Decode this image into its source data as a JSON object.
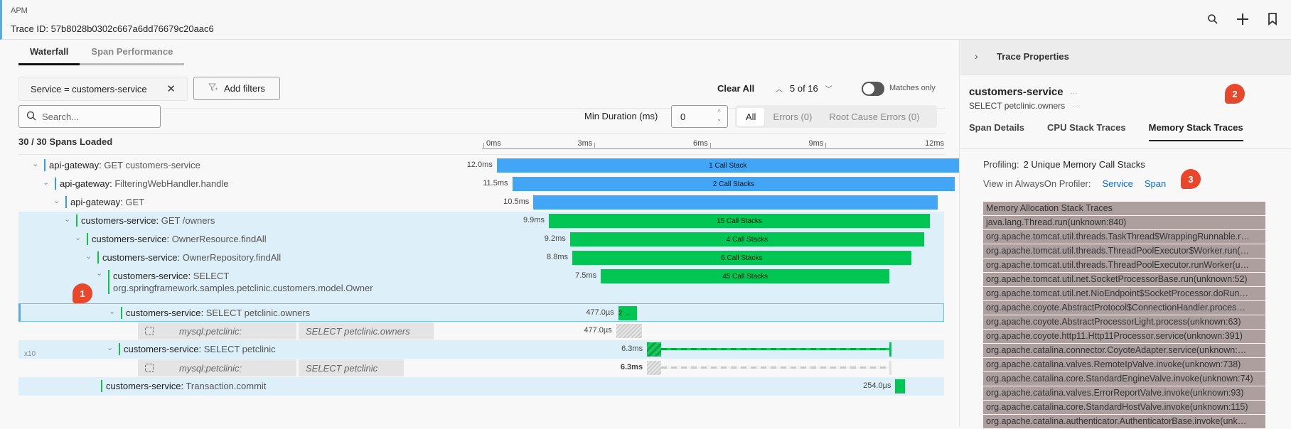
{
  "header": {
    "app_label": "APM",
    "trace_id": "Trace ID: 57b8028b0302c667a6dd76679c20aac6",
    "icons": [
      "search-icon",
      "plus-icon",
      "bookmark-icon"
    ]
  },
  "tabs": [
    {
      "label": "Waterfall",
      "active": true
    },
    {
      "label": "Span Performance",
      "active": false
    }
  ],
  "filters": {
    "chip": "Service = customers-service",
    "add_filters": "Add filters",
    "clear_all": "Clear All",
    "match_position": "5 of 16",
    "matches_only": "Matches only",
    "matches_only_on": false,
    "search_placeholder": "Search...",
    "min_duration_label": "Min Duration (ms)",
    "min_duration_value": "0",
    "segments": [
      {
        "label": "All",
        "active": true
      },
      {
        "label": "Errors (0)",
        "active": false
      },
      {
        "label": "Root Cause Errors (0)",
        "active": false
      }
    ]
  },
  "waterfall": {
    "loaded": "30 / 30 Spans Loaded",
    "axis_ticks": [
      "0ms",
      "3ms",
      "6ms",
      "9ms",
      "12ms"
    ],
    "axis_max_ms": 12,
    "colors": {
      "api_gateway": "#42a5f5",
      "customers_service": "#02c653",
      "selected_border": "#6fc4ee",
      "highlight_bg": "#ddeff8"
    },
    "rows": [
      {
        "service": "api-gateway:",
        "op": "GET customers-service",
        "duration": "12.0ms",
        "start_ms": 0.2,
        "dur_ms": 12.0,
        "bar_label": "1 Call Stack",
        "color": "blue",
        "depth": 0,
        "highlight": false
      },
      {
        "service": "api-gateway:",
        "op": "FilteringWebHandler.handle",
        "duration": "11.5ms",
        "start_ms": 0.6,
        "dur_ms": 11.5,
        "bar_label": "2 Call Stacks",
        "color": "blue",
        "depth": 1,
        "highlight": false
      },
      {
        "service": "api-gateway:",
        "op": "GET",
        "duration": "10.5ms",
        "start_ms": 1.15,
        "dur_ms": 10.5,
        "bar_label": "",
        "color": "blue",
        "depth": 2,
        "highlight": false
      },
      {
        "service": "customers-service:",
        "op": "GET /owners",
        "duration": "9.9ms",
        "start_ms": 1.55,
        "dur_ms": 9.9,
        "bar_label": "15 Call Stacks",
        "color": "green",
        "depth": 3,
        "highlight": true
      },
      {
        "service": "customers-service:",
        "op": "OwnerResource.findAll",
        "duration": "9.2ms",
        "start_ms": 2.1,
        "dur_ms": 9.2,
        "bar_label": "4 Call Stacks",
        "color": "green",
        "depth": 4,
        "highlight": true
      },
      {
        "service": "customers-service:",
        "op": "OwnerRepository.findAll",
        "duration": "8.8ms",
        "start_ms": 2.16,
        "dur_ms": 8.8,
        "bar_label": "6 Call Stacks",
        "color": "green",
        "depth": 5,
        "highlight": true
      },
      {
        "service": "customers-service:",
        "op": "SELECT",
        "op2": "org.springframework.samples.petclinic.customers.model.Owner",
        "duration": "7.5ms",
        "start_ms": 2.9,
        "dur_ms": 7.5,
        "bar_label": "45 Call Stacks",
        "color": "green",
        "depth": 6,
        "highlight": true
      },
      {
        "service": "customers-service:",
        "op": "SELECT petclinic.owners",
        "duration": "477.0µs",
        "start_ms": 3.3,
        "dur_ms": 0.477,
        "bar_label": "2 ...",
        "color": "green",
        "depth": 7,
        "highlight": true,
        "selected": true
      },
      {
        "db": "mysql:petclinic:",
        "stmt": "SELECT petclinic.owners",
        "duration": "477.0µs",
        "start_ms": 3.3,
        "dur_ms": 0.477,
        "kind": "db"
      },
      {
        "service": "customers-service:",
        "op": "SELECT petclinic",
        "duration": "6.3ms",
        "start_ms": 4.1,
        "dur_ms": 6.3,
        "repeat": "x10",
        "color": "green",
        "depth": 7,
        "highlight": true,
        "kind": "repeat"
      },
      {
        "db": "mysql:petclinic:",
        "stmt": "SELECT petclinic",
        "duration": "6.3ms",
        "start_ms": 4.1,
        "dur_ms": 6.3,
        "kind": "db-repeat"
      },
      {
        "service": "customers-service:",
        "op": "Transaction.commit",
        "duration": "254.0µs",
        "start_ms": 10.55,
        "dur_ms": 0.254,
        "color": "green",
        "depth": 6,
        "highlight": true,
        "leaf": true
      }
    ]
  },
  "right_panel": {
    "section_title": "Trace Properties",
    "service": "customers-service",
    "operation": "SELECT petclinic.owners",
    "more": "···",
    "tabs": [
      {
        "label": "Span Details",
        "active": false
      },
      {
        "label": "CPU Stack Traces",
        "active": false
      },
      {
        "label": "Memory Stack Traces",
        "active": true
      }
    ],
    "profiling_label": "Profiling:",
    "profiling_value": "2 Unique Memory Call Stacks",
    "view_label": "View in AlwaysOn Profiler:",
    "links": [
      "Service",
      "Span"
    ],
    "stack_title": "Memory Allocation Stack Traces",
    "stack": [
      "java.lang.Thread.run(unknown:840)",
      "org.apache.tomcat.util.threads.TaskThread$WrappingRunnable.r…",
      "org.apache.tomcat.util.threads.ThreadPoolExecutor$Worker.run(…",
      "org.apache.tomcat.util.threads.ThreadPoolExecutor.runWorker(u…",
      "org.apache.tomcat.util.net.SocketProcessorBase.run(unknown:52)",
      "org.apache.tomcat.util.net.NioEndpoint$SocketProcessor.doRun…",
      "org.apache.coyote.AbstractProtocol$ConnectionHandler.proces…",
      "org.apache.coyote.AbstractProcessorLight.process(unknown:63)",
      "org.apache.coyote.http11.Http11Processor.service(unknown:391)",
      "org.apache.catalina.connector.CoyoteAdapter.service(unknown:…",
      "org.apache.catalina.valves.RemoteIpValve.invoke(unknown:738)",
      "org.apache.catalina.core.StandardEngineValve.invoke(unknown:74)",
      "org.apache.catalina.valves.ErrorReportValve.invoke(unknown:93)",
      "org.apache.catalina.core.StandardHostValve.invoke(unknown:115)",
      "org.apache.catalina.authenticator.AuthenticatorBase.invoke(unk…"
    ]
  },
  "annotations": [
    "1",
    "2",
    "3"
  ]
}
